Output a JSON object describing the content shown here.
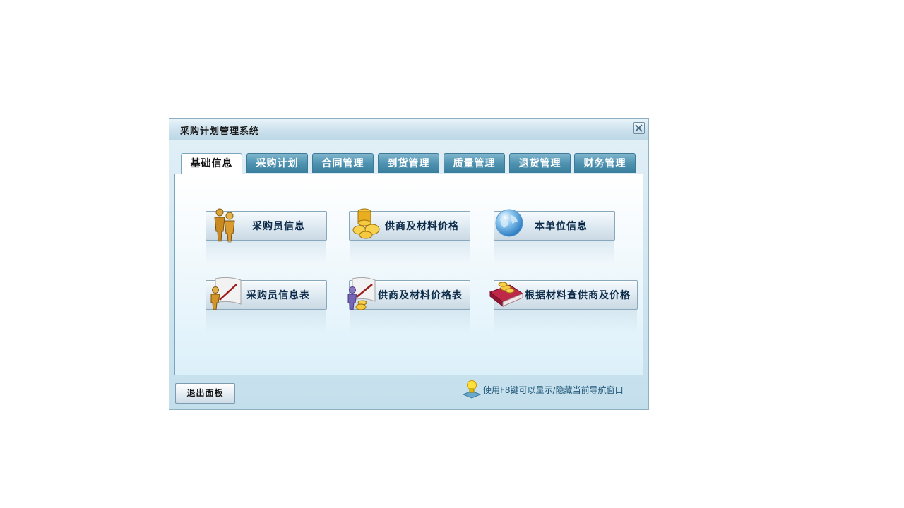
{
  "window": {
    "title": "采购计划管理系统"
  },
  "tabs": [
    {
      "label": "基础信息",
      "active": true
    },
    {
      "label": "采购计划",
      "active": false
    },
    {
      "label": "合同管理",
      "active": false
    },
    {
      "label": "到货管理",
      "active": false
    },
    {
      "label": "质量管理",
      "active": false
    },
    {
      "label": "退货管理",
      "active": false
    },
    {
      "label": "财务管理",
      "active": false
    }
  ],
  "buttons": [
    {
      "label": "采购员信息",
      "icon": "people-icon"
    },
    {
      "label": "供商及材料价格",
      "icon": "coins-icon"
    },
    {
      "label": "本单位信息",
      "icon": "globe-icon"
    },
    {
      "label": "采购员信息表",
      "icon": "person-document-icon"
    },
    {
      "label": "供商及材料价格表",
      "icon": "person-coins-document-icon"
    },
    {
      "label": "根据材料查供商及价格",
      "icon": "book-coins-icon"
    }
  ],
  "footer": {
    "exit_label": "退出面板",
    "hint": "使用F8键可以显示/隐藏当前导航窗口",
    "hint_icon": "lightbulb-icon"
  },
  "colors": {
    "tab_bg": "#4f93b1",
    "tab_text": "#ffffff",
    "button_text": "#0c2a48",
    "hint_text": "#1d5577"
  }
}
